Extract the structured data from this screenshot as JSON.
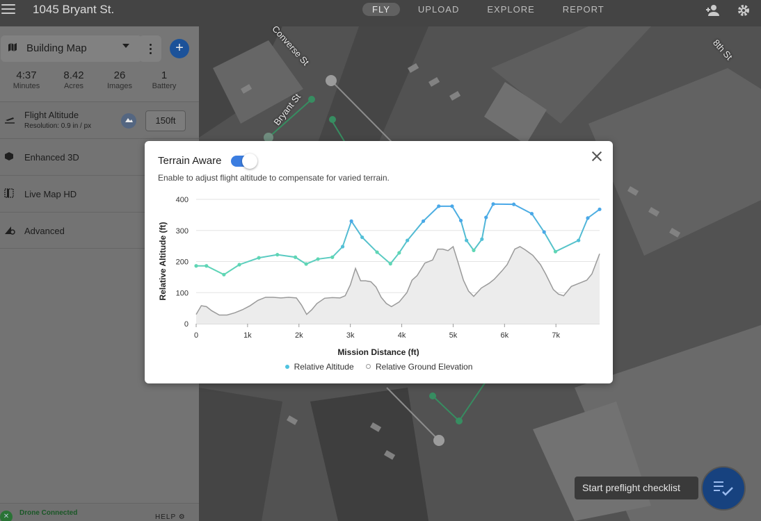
{
  "header": {
    "title": "1045 Bryant St.",
    "tabs": [
      {
        "label": "FLY",
        "active": true
      },
      {
        "label": "UPLOAD"
      },
      {
        "label": "EXPLORE"
      },
      {
        "label": "REPORT"
      }
    ],
    "icons": [
      "menu-icon",
      "team-icon",
      "settings-icon"
    ]
  },
  "sidebar": {
    "mission_type": "Building Map",
    "stats": [
      {
        "value": "4:37",
        "label": "Minutes"
      },
      {
        "value": "8.42",
        "label": "Acres"
      },
      {
        "value": "26",
        "label": "Images"
      },
      {
        "value": "1",
        "label": "Battery"
      }
    ],
    "items": [
      {
        "label": "Flight Altitude",
        "sublabel": "Resolution: 0.9 in / px",
        "value": "150ft"
      },
      {
        "label": "Enhanced 3D"
      },
      {
        "label": "Live Map HD"
      },
      {
        "label": "Advanced"
      }
    ],
    "footer": {
      "status": "Drone Connected",
      "help": "HELP"
    }
  },
  "map": {
    "labels": [
      "Converse St",
      "Bryant St",
      "8th St"
    ]
  },
  "modal": {
    "title": "Terrain Aware",
    "toggle_on": true,
    "description": "Enable to adjust flight altitude to compensate for varied terrain.",
    "legend": [
      {
        "label": "Relative Altitude",
        "color": "#4fc3e0"
      },
      {
        "label": "Relative Ground Elevation",
        "color": "#999999"
      }
    ]
  },
  "chart_data": {
    "type": "line",
    "xlabel": "Mission Distance (ft)",
    "ylabel": "Relative Altitude (ft)",
    "xlim": [
      0,
      7850
    ],
    "ylim": [
      0,
      400
    ],
    "xticks": [
      0,
      1000,
      2000,
      3000,
      4000,
      5000,
      6000,
      7000
    ],
    "xtick_labels": [
      "0",
      "1k",
      "2k",
      "3k",
      "4k",
      "5k",
      "6k",
      "7k"
    ],
    "yticks": [
      0,
      100,
      200,
      300,
      400
    ],
    "series": [
      {
        "name": "Relative Altitude",
        "x": [
          0,
          200,
          540,
          840,
          1220,
          1580,
          1930,
          2140,
          2370,
          2650,
          2850,
          3020,
          3230,
          3520,
          3780,
          3950,
          4110,
          4420,
          4720,
          4980,
          5150,
          5260,
          5400,
          5560,
          5640,
          5780,
          6180,
          6530,
          6770,
          6990,
          7440,
          7620,
          7850
        ],
        "y": [
          186,
          186,
          158,
          190,
          212,
          222,
          214,
          192,
          208,
          214,
          248,
          330,
          278,
          230,
          193,
          228,
          268,
          330,
          378,
          378,
          332,
          268,
          236,
          272,
          342,
          385,
          384,
          354,
          295,
          232,
          268,
          340,
          368
        ]
      },
      {
        "name": "Relative Ground Elevation",
        "x": [
          0,
          100,
          200,
          300,
          450,
          600,
          750,
          900,
          1050,
          1200,
          1350,
          1500,
          1650,
          1800,
          1950,
          2050,
          2150,
          2250,
          2350,
          2500,
          2650,
          2800,
          2900,
          3000,
          3100,
          3200,
          3300,
          3400,
          3500,
          3600,
          3700,
          3800,
          3950,
          4100,
          4200,
          4300,
          4450,
          4600,
          4700,
          4800,
          4900,
          5000,
          5100,
          5200,
          5300,
          5400,
          5550,
          5700,
          5800,
          5950,
          6050,
          6200,
          6300,
          6400,
          6550,
          6700,
          6800,
          6950,
          7050,
          7150,
          7300,
          7450,
          7600,
          7700,
          7850
        ],
        "y": [
          30,
          58,
          55,
          42,
          28,
          28,
          35,
          45,
          58,
          75,
          85,
          85,
          83,
          85,
          83,
          60,
          30,
          45,
          65,
          82,
          84,
          83,
          90,
          125,
          178,
          138,
          138,
          135,
          118,
          85,
          65,
          55,
          70,
          100,
          140,
          155,
          195,
          205,
          240,
          240,
          235,
          248,
          195,
          140,
          105,
          88,
          115,
          130,
          143,
          170,
          190,
          240,
          248,
          238,
          220,
          190,
          160,
          110,
          95,
          90,
          120,
          130,
          140,
          160,
          225
        ]
      }
    ]
  },
  "preflight": {
    "label": "Start preflight checklist"
  }
}
